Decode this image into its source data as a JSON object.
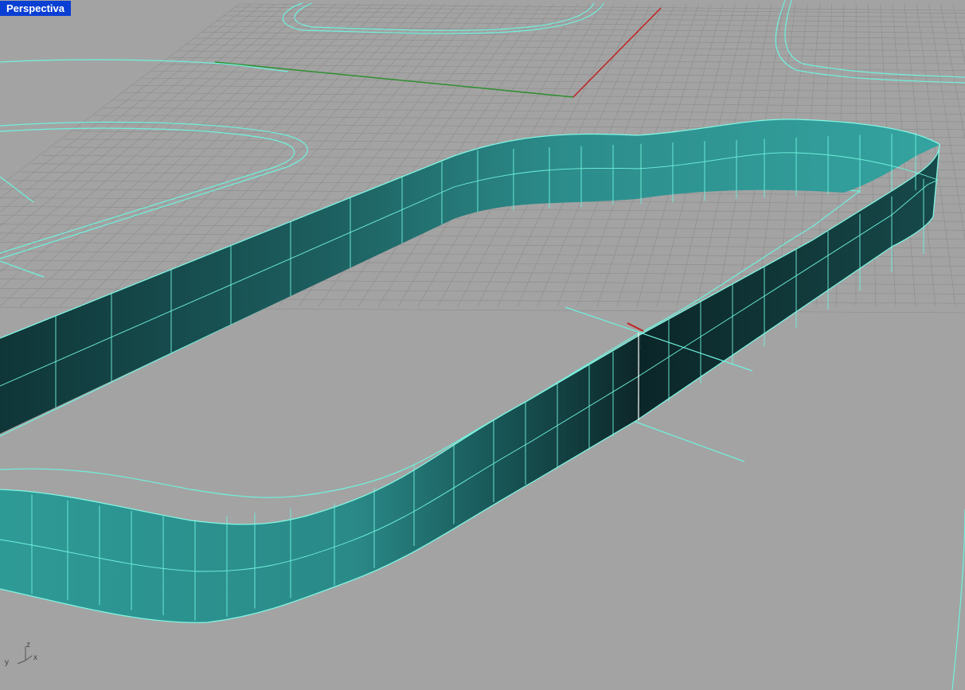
{
  "viewport": {
    "name": "Perspectiva",
    "title_bg": "#0a3fd4"
  },
  "axis_indicator": {
    "z": "z",
    "y": "y",
    "x": "x"
  },
  "colors": {
    "background": "#a3a3a3",
    "grid": "#8c8c8c",
    "curve": "#6ff2dd",
    "surface_light": "#2f9494",
    "surface_dark": "#0b2426",
    "x_axis": "#c22121",
    "y_axis": "#2f8f2f",
    "selection": "#ffffff"
  }
}
